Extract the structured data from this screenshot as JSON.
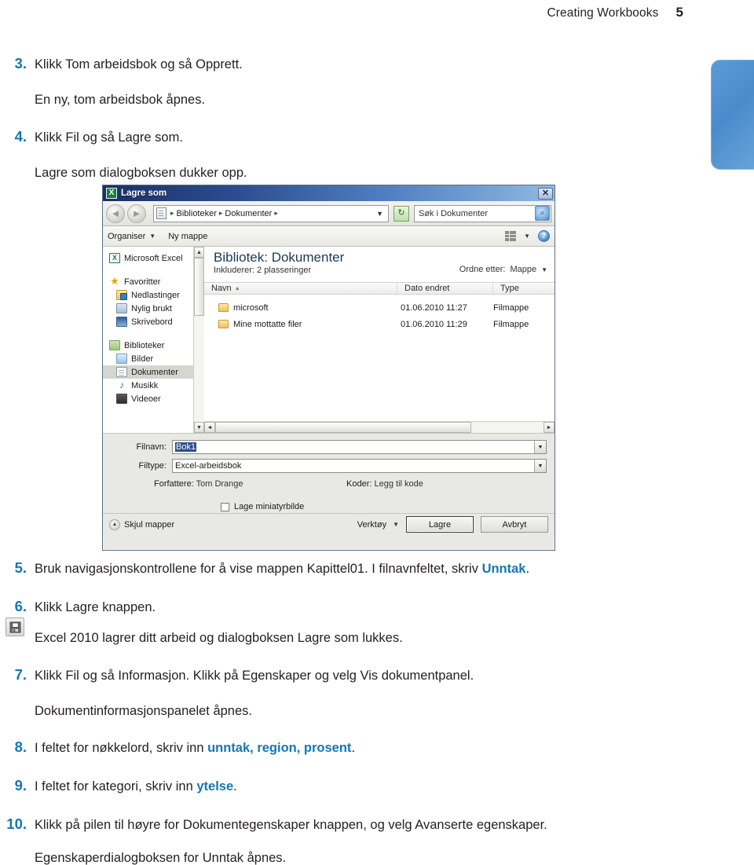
{
  "header": {
    "title": "Creating Workbooks",
    "page_number": "5"
  },
  "margin_icon": {
    "name": "save-floppy-icon"
  },
  "steps_top": [
    {
      "number": "3.",
      "text": "Klikk Tom arbeidsbok og så Opprett.",
      "note": "En ny, tom arbeidsbok åpnes."
    },
    {
      "number": "4.",
      "text": "Klikk Fil og så Lagre som.",
      "note": "Lagre som dialogboksen dukker opp."
    }
  ],
  "steps_bottom": [
    {
      "number": "5.",
      "text_before": "Bruk navigasjonskontrollene for å vise mappen Kapittel01. I filnavnfeltet, skriv",
      "highlight": "Unntak",
      "text_after": ".",
      "note": ""
    },
    {
      "number": "6.",
      "text_before": "Klikk Lagre knappen.",
      "highlight": "",
      "text_after": "",
      "note": "Excel 2010 lagrer ditt arbeid og dialogboksen Lagre som lukkes."
    },
    {
      "number": "7.",
      "text_before": "Klikk Fil og så Informasjon. Klikk på Egenskaper og velg Vis dokumentpanel.",
      "highlight": "",
      "text_after": "",
      "note": "Dokumentinformasjonspanelet åpnes."
    },
    {
      "number": "8.",
      "text_before": "I feltet for nøkkelord, skriv inn ",
      "highlight": "unntak, region, prosent",
      "text_after": ".",
      "note": ""
    },
    {
      "number": "9.",
      "text_before": "I feltet for kategori, skriv inn ",
      "highlight": "ytelse",
      "text_after": ".",
      "note": ""
    },
    {
      "number": "10.",
      "text_before": "Klikk på pilen til høyre for Dokumentegenskaper knappen, og velg Avanserte egenskaper.",
      "highlight": "",
      "text_after": "",
      "note": "Egenskaperdialogboksen for Unntak åpnes."
    }
  ],
  "dialog": {
    "title": "Lagre som",
    "app_badge": "X",
    "close_label": "✕",
    "nav": {
      "back_icon": "◄",
      "forward_icon": "►",
      "breadcrumbs": [
        "Biblioteker",
        "Dokumenter"
      ],
      "breadcrumb_separator": "▸",
      "address_dropdown": "▼",
      "refresh_icon": "↻",
      "search_text": "Søk i Dokumenter",
      "search_button_icon": "⌕"
    },
    "commandbar": {
      "organize": "Organiser",
      "organize_caret": "▼",
      "new_folder": "Ny mappe",
      "view_caret": "▼",
      "help_label": "?"
    },
    "sidebar": [
      {
        "label": "Microsoft Excel",
        "icon": "excel-icon",
        "indent": false,
        "selected": false
      },
      {
        "label": "Favoritter",
        "icon": "star-icon",
        "indent": false,
        "selected": false
      },
      {
        "label": "Nedlastinger",
        "icon": "downloads-folder-icon",
        "indent": true,
        "selected": false
      },
      {
        "label": "Nylig brukt",
        "icon": "recent-places-icon",
        "indent": true,
        "selected": false
      },
      {
        "label": "Skrivebord",
        "icon": "desktop-icon",
        "indent": true,
        "selected": false
      },
      {
        "label": "Biblioteker",
        "icon": "libraries-icon",
        "indent": false,
        "selected": false
      },
      {
        "label": "Bilder",
        "icon": "pictures-icon",
        "indent": true,
        "selected": false
      },
      {
        "label": "Dokumenter",
        "icon": "documents-icon",
        "indent": true,
        "selected": true
      },
      {
        "label": "Musikk",
        "icon": "music-icon",
        "indent": true,
        "selected": false
      },
      {
        "label": "Videoer",
        "icon": "videos-icon",
        "indent": true,
        "selected": false
      }
    ],
    "library": {
      "title": "Bibliotek: Dokumenter",
      "subtitle": "Inkluderer:  2 plasseringer",
      "arrange_label": "Ordne etter:",
      "arrange_value": "Mappe",
      "arrange_caret": "▼"
    },
    "columns": [
      "Navn",
      "Dato endret",
      "Type"
    ],
    "sort_indicator": "▲",
    "files": [
      {
        "name": "microsoft",
        "date": "01.06.2010 11:27",
        "type": "Filmappe"
      },
      {
        "name": "Mine mottatte filer",
        "date": "01.06.2010 11:29",
        "type": "Filmappe"
      }
    ],
    "form": {
      "filename_label": "Filnavn:",
      "filename_value": "Bok1",
      "filetype_label": "Filtype:",
      "filetype_value": "Excel-arbeidsbok",
      "authors_label": "Forfattere:",
      "authors_value": "Tom Drange",
      "tags_label": "Koder:",
      "tags_value": "Legg til kode",
      "thumbnail_label": "Lage miniatyrbilde",
      "combo_arrow": "▼"
    },
    "footer": {
      "hide_folders": "Skjul mapper",
      "hide_folders_icon": "▲",
      "tools": "Verktøy",
      "tools_caret": "▼",
      "save": "Lagre",
      "cancel": "Avbryt"
    }
  },
  "colors": {
    "accent_blue": "#1576b6",
    "title_bar_start": "#1b2f66",
    "title_bar_end": "#93b9e2",
    "dialog_face": "#e8e8e4",
    "tab_blue": "#4a8ccb"
  }
}
